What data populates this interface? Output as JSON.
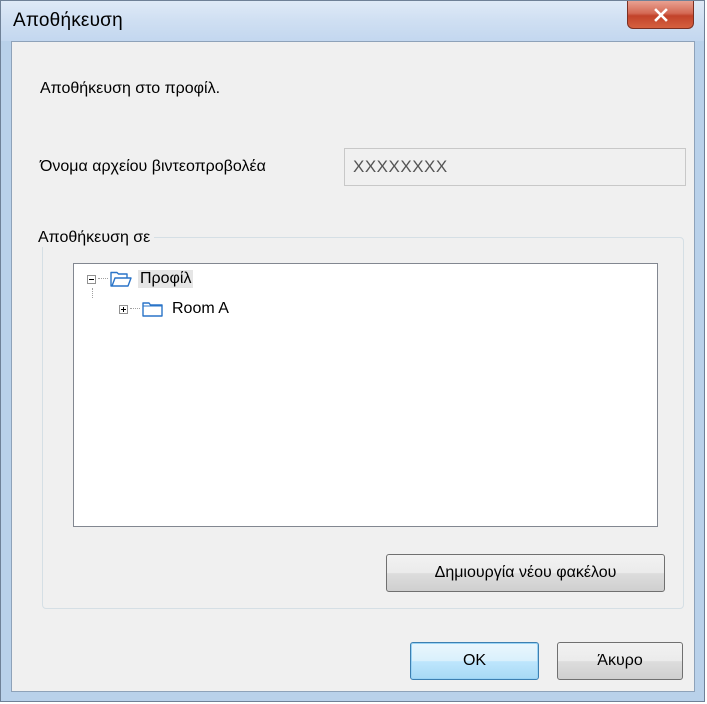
{
  "window": {
    "title": "Αποθήκευση",
    "close_glyph": "✕"
  },
  "content": {
    "intro_text": "Αποθήκευση στο προφίλ.",
    "filename_label": "Όνομα αρχείου βιντεοπροβολέα",
    "filename_value": "XXXXXXXX",
    "save_in_label": "Αποθήκευση σε"
  },
  "tree": {
    "root": {
      "label": "Προφίλ",
      "expanded": true,
      "icon": "folder-open-icon"
    },
    "children": [
      {
        "label": "Room A",
        "expanded": false,
        "icon": "folder-icon"
      }
    ]
  },
  "buttons": {
    "new_folder": "Δημιουργία νέου φακέλου",
    "ok": "OK",
    "cancel": "Άκυρο"
  },
  "colors": {
    "close_button": "#c7442b",
    "default_button_border": "#3c7fb1",
    "folder_outline": "#2a74c8"
  }
}
